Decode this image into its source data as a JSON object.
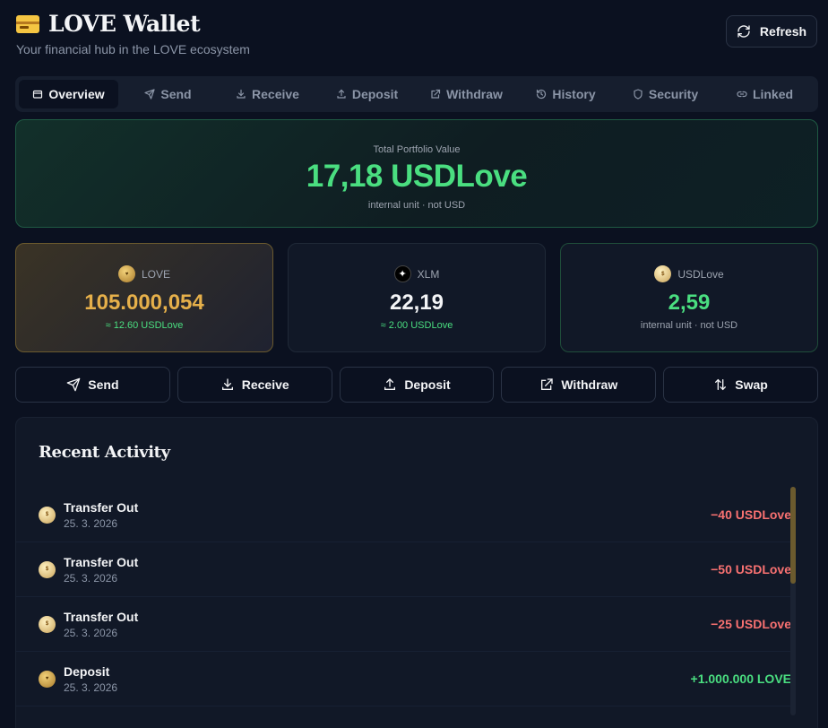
{
  "header": {
    "title": "LOVE Wallet",
    "subtitle": "Your financial hub in the LOVE ecosystem",
    "refresh_label": "Refresh"
  },
  "tabs": [
    {
      "label": "Overview",
      "icon": "wallet-icon",
      "active": true
    },
    {
      "label": "Send",
      "icon": "send-icon"
    },
    {
      "label": "Receive",
      "icon": "download-icon"
    },
    {
      "label": "Deposit",
      "icon": "upload-icon"
    },
    {
      "label": "Withdraw",
      "icon": "external-link-icon"
    },
    {
      "label": "History",
      "icon": "history-icon"
    },
    {
      "label": "Security",
      "icon": "shield-icon"
    },
    {
      "label": "Linked",
      "icon": "link-icon"
    }
  ],
  "portfolio": {
    "label": "Total Portfolio Value",
    "value": "17,18 USDLove",
    "note": "internal unit · not USD"
  },
  "assets": [
    {
      "name": "LOVE",
      "amount": "105.000,054",
      "sub": "≈ 12.60 USDLove"
    },
    {
      "name": "XLM",
      "amount": "22,19",
      "sub": "≈ 2.00 USDLove"
    },
    {
      "name": "USDLove",
      "amount": "2,59",
      "sub": "internal unit · not USD"
    }
  ],
  "actions": [
    {
      "label": "Send",
      "icon": "send-icon"
    },
    {
      "label": "Receive",
      "icon": "download-icon"
    },
    {
      "label": "Deposit",
      "icon": "upload-icon"
    },
    {
      "label": "Withdraw",
      "icon": "external-link-icon"
    },
    {
      "label": "Swap",
      "icon": "swap-icon"
    }
  ],
  "activity": {
    "title": "Recent Activity",
    "items": [
      {
        "name": "Transfer Out",
        "date": "25. 3. 2026",
        "amount": "−40 USDLove",
        "sign": "neg"
      },
      {
        "name": "Transfer Out",
        "date": "25. 3. 2026",
        "amount": "−50 USDLove",
        "sign": "neg"
      },
      {
        "name": "Transfer Out",
        "date": "25. 3. 2026",
        "amount": "−25 USDLove",
        "sign": "neg"
      },
      {
        "name": "Deposit",
        "date": "25. 3. 2026",
        "amount": "+1.000.000 LOVE",
        "sign": "pos"
      }
    ]
  },
  "colors": {
    "accent_green": "#4ade80",
    "accent_gold": "#e6b04a",
    "negative_red": "#f87171",
    "background": "#0b1120"
  }
}
